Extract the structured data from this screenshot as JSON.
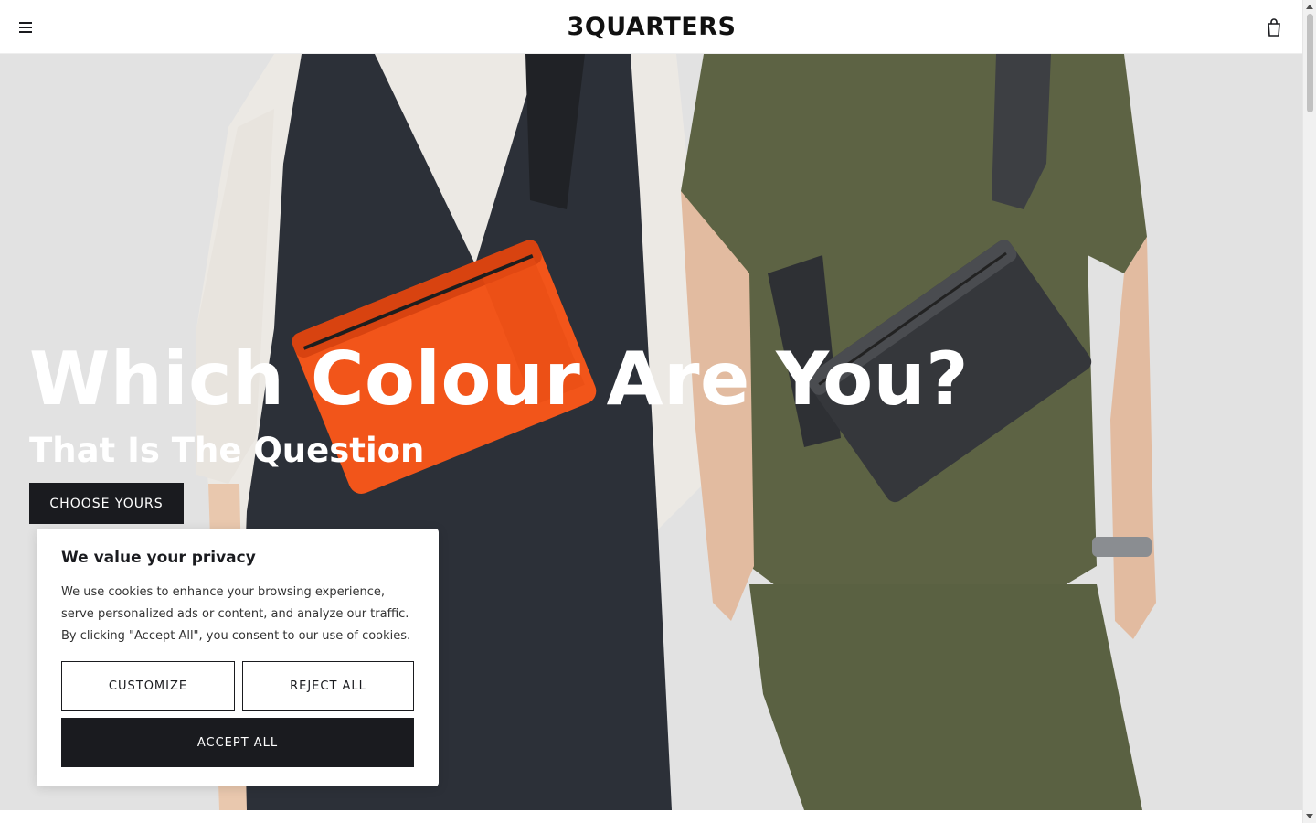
{
  "header": {
    "menu_icon": "hamburger-menu-icon",
    "logo_text": "3QUARTERS",
    "cart_icon": "shopping-bag-icon"
  },
  "hero": {
    "title": "Which Colour Are You?",
    "subtitle": "That Is The Question",
    "cta_label": "CHOOSE YOURS",
    "image_description_icon": "hero-photo"
  },
  "cookie_banner": {
    "title": "We value your privacy",
    "text": "We use cookies to enhance your browsing experience, serve personalized ads or content, and analyze our traffic. By clicking \"Accept All\", you consent to our use of cookies.",
    "customize_label": "CUSTOMIZE",
    "reject_label": "REJECT ALL",
    "accept_label": "ACCEPT ALL"
  },
  "colors": {
    "dark": "#1a1b1f",
    "orange_bag": "#f2551a",
    "olive": "#5d6344",
    "background": "#e2e2e2"
  }
}
